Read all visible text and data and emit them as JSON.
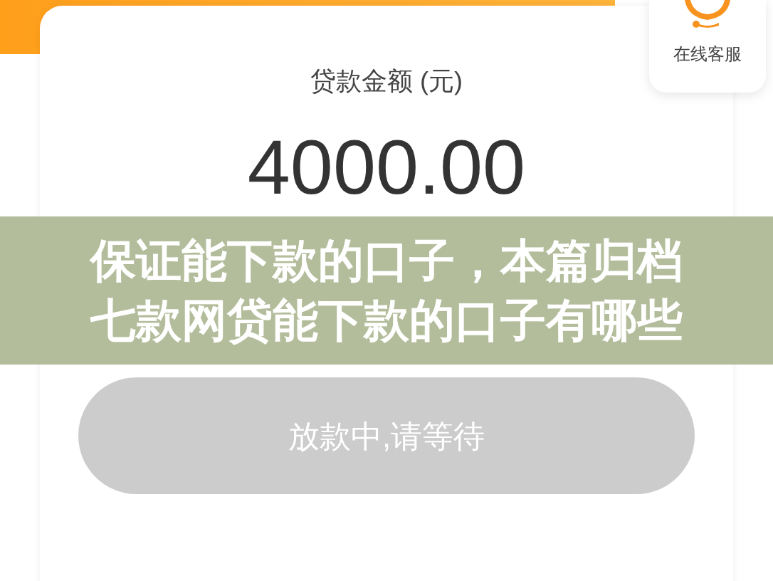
{
  "service": {
    "label": "在线客服"
  },
  "amount_card": {
    "label": "贷款金额 (元)",
    "amount": "4000.00"
  },
  "banner": {
    "lines": [
      "保证能下款的口子，本篇归档",
      "七款网贷能下款的口子有哪些"
    ]
  },
  "button": {
    "label": "放款中,请等待",
    "disabled": true
  }
}
